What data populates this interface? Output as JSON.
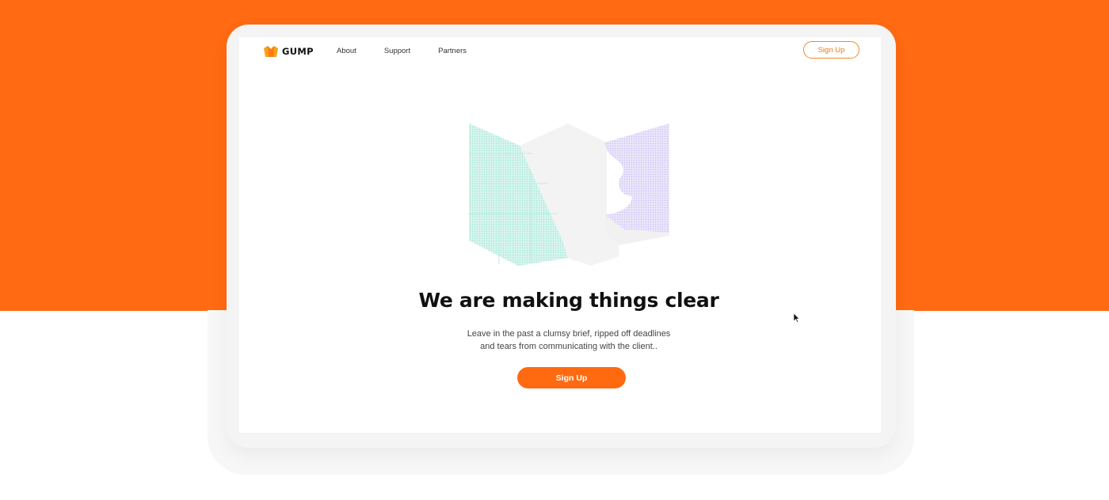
{
  "colors": {
    "page_background": "#ff6a12",
    "accent": "#ff6a10",
    "outline_button": "#f08a2a"
  },
  "brand": {
    "name": "GUMP",
    "logo_icon": "crown-logo-icon"
  },
  "nav": {
    "items": [
      {
        "label": "About"
      },
      {
        "label": "Support"
      },
      {
        "label": "Partners"
      }
    ]
  },
  "header": {
    "signup_label": "Sign Up"
  },
  "hero": {
    "illustration_icon": "folded-map-illustration",
    "title": "We are making things clear",
    "subtitle_line1": "Leave in the past a clumsy brief, ripped off deadlines",
    "subtitle_line2": "and tears from communicating with the client..",
    "cta_label": "Sign Up"
  },
  "pointer_icon": "mouse-cursor-icon"
}
